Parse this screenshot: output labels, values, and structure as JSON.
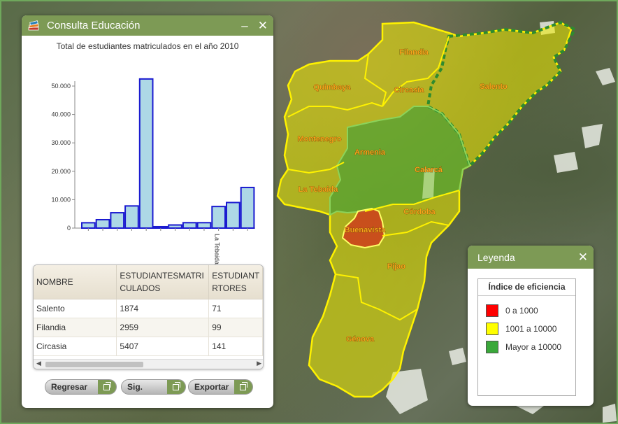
{
  "map": {
    "municipalities": [
      {
        "name": "Filandia",
        "label": "Filandia"
      },
      {
        "name": "Quimbaya",
        "label": "Quimbaya"
      },
      {
        "name": "Circasia",
        "label": "Circasia"
      },
      {
        "name": "Salento",
        "label": "Salento"
      },
      {
        "name": "Montenegro",
        "label": "Montenegro"
      },
      {
        "name": "Armenia",
        "label": "Armenia"
      },
      {
        "name": "Calarcá",
        "label": "Calarcá"
      },
      {
        "name": "La Tebaida",
        "label": "La Tebaida"
      },
      {
        "name": "Córdoba",
        "label": "Córdoba"
      },
      {
        "name": "Buenavista",
        "label": "Buenavista"
      },
      {
        "name": "Pijao",
        "label": "Pijao"
      },
      {
        "name": "Génova",
        "label": "Génova"
      }
    ],
    "colors": {
      "low": "#e11b1b",
      "mid": "#f5f000",
      "high": "#3aa83a"
    }
  },
  "consulta": {
    "title": "Consulta Educación",
    "minimize_icon": "minus-icon",
    "close_icon": "close-icon",
    "chart_title": "Total de estudiantes matriculados en el año 2010",
    "table": {
      "columns": [
        "NOMBRE",
        "ESTUDIANTESMATRI CULADOS",
        "ESTUDIANT RTORES"
      ],
      "rows": [
        [
          "Salento",
          "1874",
          "71"
        ],
        [
          "Filandia",
          "2959",
          "99"
        ],
        [
          "Circasia",
          "5407",
          "141"
        ]
      ]
    },
    "buttons": {
      "back": "Regresar",
      "next": "Sig.",
      "export": "Exportar"
    }
  },
  "chart_data": {
    "type": "bar",
    "title": "Total de estudiantes matriculados en el año 2010",
    "xlabel": "",
    "ylabel": "",
    "ylim": [
      0,
      50000
    ],
    "yticks": [
      "0",
      "10.000",
      "20.000",
      "30.000",
      "40.000",
      "50.000"
    ],
    "visible_xtick_label": "La Tebaida",
    "values": [
      1874,
      2959,
      5407,
      7800,
      52500,
      500,
      1100,
      1900,
      1900,
      7600,
      9000,
      14300
    ],
    "bar_color": "#add8e6",
    "bar_border": "#1a1ad0"
  },
  "legend": {
    "title": "Leyenda",
    "heading": "Índice de eficiencia",
    "items": [
      {
        "label": "0 a 1000",
        "color": "#ff0000"
      },
      {
        "label": "1001 a 10000",
        "color": "#ffff00"
      },
      {
        "label": "Mayor a 10000",
        "color": "#3aa83a"
      }
    ]
  }
}
